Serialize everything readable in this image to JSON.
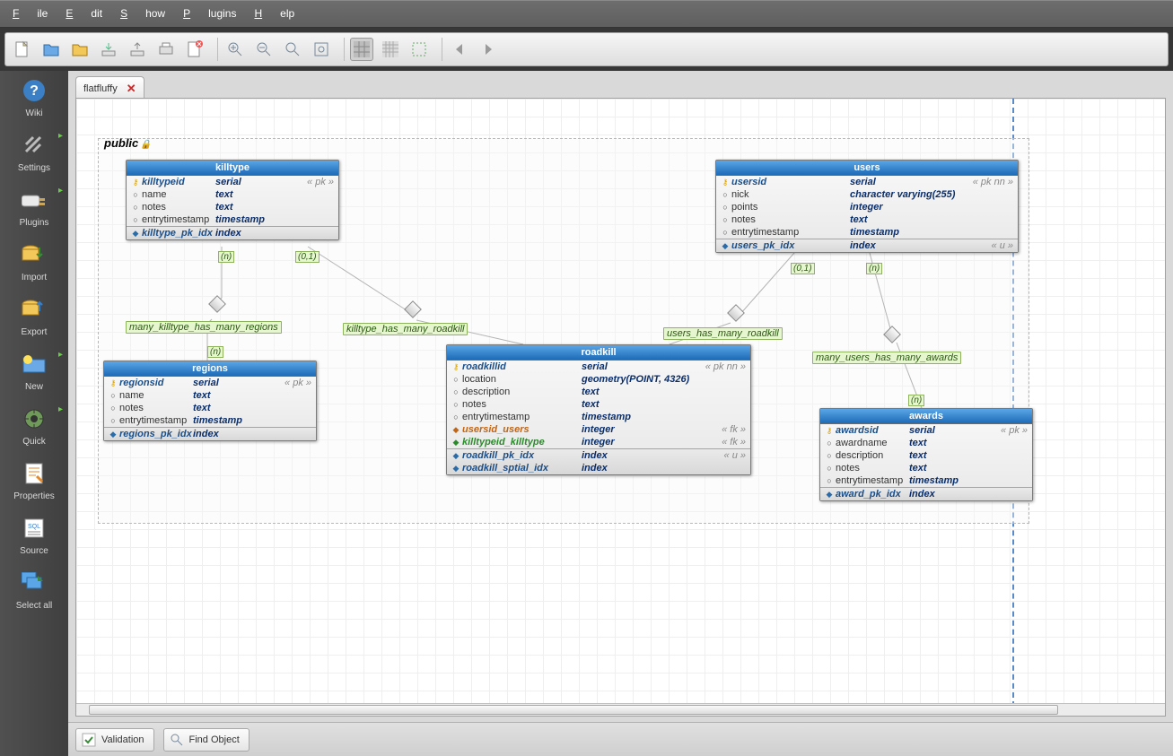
{
  "menu": {
    "file": "File",
    "edit": "Edit",
    "show": "Show",
    "plugins": "Plugins",
    "help": "Help"
  },
  "launcher": [
    {
      "id": "wiki",
      "label": "Wiki"
    },
    {
      "id": "settings",
      "label": "Settings"
    },
    {
      "id": "plugins",
      "label": "Plugins"
    },
    {
      "id": "import",
      "label": "Import"
    },
    {
      "id": "export",
      "label": "Export"
    },
    {
      "id": "new",
      "label": "New"
    },
    {
      "id": "quick",
      "label": "Quick"
    },
    {
      "id": "properties",
      "label": "Properties"
    },
    {
      "id": "source",
      "label": "Source"
    },
    {
      "id": "selectall",
      "label": "Select all"
    }
  ],
  "tab": {
    "name": "flatfluffy"
  },
  "schema": {
    "name": "public"
  },
  "entities": {
    "killtype": {
      "title": "killtype",
      "rows": [
        {
          "pk": true,
          "name": "killtypeid",
          "type": "serial",
          "con": "« pk »"
        },
        {
          "name": "name",
          "type": "text"
        },
        {
          "name": "notes",
          "type": "text"
        },
        {
          "name": "entrytimestamp",
          "type": "timestamp"
        }
      ],
      "idx": [
        {
          "name": "killtype_pk_idx",
          "type": "index"
        }
      ]
    },
    "users": {
      "title": "users",
      "rows": [
        {
          "pk": true,
          "name": "usersid",
          "type": "serial",
          "con": "« pk nn »"
        },
        {
          "name": "nick",
          "type": "character varying(255)"
        },
        {
          "name": "points",
          "type": "integer"
        },
        {
          "name": "notes",
          "type": "text"
        },
        {
          "name": "entrytimestamp",
          "type": "timestamp"
        }
      ],
      "idx": [
        {
          "name": "users_pk_idx",
          "type": "index",
          "con": "« u »"
        }
      ]
    },
    "regions": {
      "title": "regions",
      "rows": [
        {
          "pk": true,
          "name": "regionsid",
          "type": "serial",
          "con": "« pk »"
        },
        {
          "name": "name",
          "type": "text"
        },
        {
          "name": "notes",
          "type": "text"
        },
        {
          "name": "entrytimestamp",
          "type": "timestamp"
        }
      ],
      "idx": [
        {
          "name": "regions_pk_idx",
          "type": "index"
        }
      ]
    },
    "roadkill": {
      "title": "roadkill",
      "rows": [
        {
          "pk": true,
          "name": "roadkillid",
          "type": "serial",
          "con": "« pk nn »"
        },
        {
          "name": "location",
          "type": "geometry(POINT, 4326)"
        },
        {
          "name": "description",
          "type": "text"
        },
        {
          "name": "notes",
          "type": "text"
        },
        {
          "name": "entrytimestamp",
          "type": "timestamp"
        },
        {
          "fk": "orange",
          "name": "usersid_users",
          "type": "integer",
          "con": "« fk »"
        },
        {
          "fk": "green",
          "name": "killtypeid_killtype",
          "type": "integer",
          "con": "« fk »"
        }
      ],
      "idx": [
        {
          "name": "roadkill_pk_idx",
          "type": "index",
          "con": "« u »"
        },
        {
          "name": "roadkill_sptial_idx",
          "type": "index"
        }
      ]
    },
    "awards": {
      "title": "awards",
      "rows": [
        {
          "pk": true,
          "name": "awardsid",
          "type": "serial",
          "con": "« pk »"
        },
        {
          "name": "awardname",
          "type": "text"
        },
        {
          "name": "description",
          "type": "text"
        },
        {
          "name": "notes",
          "type": "text"
        },
        {
          "name": "entrytimestamp",
          "type": "timestamp"
        }
      ],
      "idx": [
        {
          "name": "award_pk_idx",
          "type": "index"
        }
      ]
    }
  },
  "relationships": {
    "r1": "many_killtype_has_many_regions",
    "r2": "killtype_has_many_roadkill",
    "r3": "users_has_many_roadkill",
    "r4": "many_users_has_many_awards"
  },
  "cardinalities": {
    "k1": "(n)",
    "k2": "(0,1)",
    "k3": "(n)",
    "k4": "(0,1)",
    "k5": "(n)",
    "k6": "(n)"
  },
  "bottombar": {
    "validation": "Validation",
    "find": "Find Object"
  }
}
